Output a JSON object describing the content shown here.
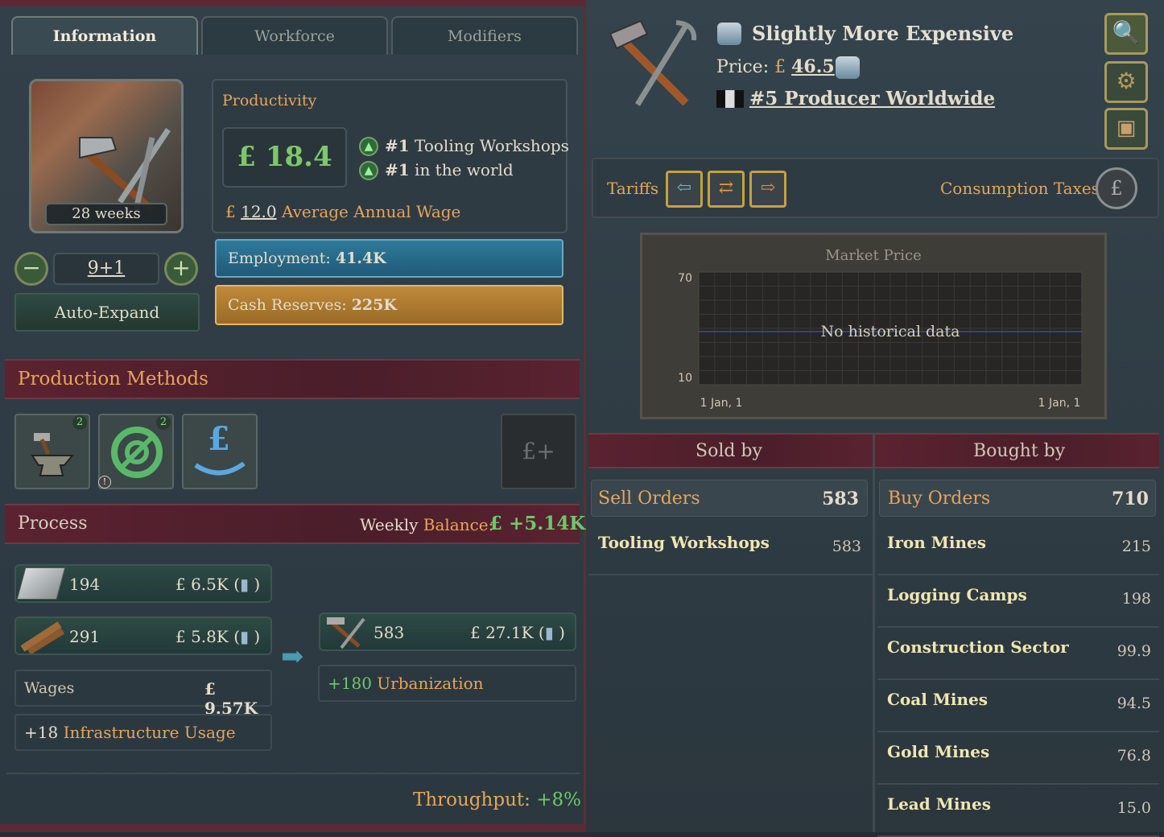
{
  "tabs": {
    "information": "Information",
    "workforce": "Workforce",
    "modifiers": "Modifiers"
  },
  "building": {
    "weeks": "28 weeks",
    "level": "9+1",
    "auto_expand": "Auto-Expand"
  },
  "productivity": {
    "title": "Productivity",
    "value": "£ 18.4",
    "rank1_prefix": "#1",
    "rank1_text": "Tooling Workshops",
    "rank2_prefix": "#1",
    "rank2_text": "in the world",
    "wage_currency": "£",
    "wage_value": "12.0",
    "wage_label": "Average Annual Wage"
  },
  "employment": {
    "label": "Employment:",
    "value": "41.4K"
  },
  "cash": {
    "label": "Cash Reserves:",
    "value": "225K"
  },
  "production_methods": {
    "title": "Production Methods",
    "badge1": "2",
    "badge2": "2",
    "currency_btn": "£+"
  },
  "process": {
    "title": "Process",
    "balance_prefix": "Weekly",
    "balance_label": "Balance:",
    "balance_value": "£ +5.14K",
    "inputs": [
      {
        "qty": "194",
        "cost": "£ 6.5K ("
      },
      {
        "qty": "291",
        "cost": "£ 5.8K ("
      }
    ],
    "wages_label": "Wages",
    "wages_value": "£ 9.57K",
    "infra_value": "+18",
    "infra_label": "Infrastructure Usage",
    "output": {
      "qty": "583",
      "value": "£ 27.1K ("
    },
    "urban_value": "+180",
    "urban_label": "Urbanization",
    "throughput_label": "Throughput:",
    "throughput_value": "+8%"
  },
  "goods": {
    "name": "Slightly More Expensive",
    "price_label": "Price:",
    "price_currency": "£",
    "price_value": "46.5",
    "producer_rank": "#5 Producer Worldwide"
  },
  "tariffs": {
    "label": "Tariffs",
    "consumption_label": "Consumption Taxes"
  },
  "chart_data": {
    "type": "line",
    "title": "Market Price",
    "ylim": [
      10,
      70
    ],
    "yticks": [
      "70",
      "10"
    ],
    "xticks": [
      "1 Jan, 1",
      "1 Jan, 1"
    ],
    "annotation": "No historical data",
    "series": []
  },
  "market": {
    "sold_by": "Sold by",
    "bought_by": "Bought by",
    "sell_orders_label": "Sell Orders",
    "sell_orders_value": "583",
    "buy_orders_label": "Buy Orders",
    "buy_orders_value": "710",
    "sellers": [
      {
        "name": "Tooling Workshops",
        "value": "583"
      }
    ],
    "buyers": [
      {
        "name": "Iron Mines",
        "value": "215"
      },
      {
        "name": "Logging Camps",
        "value": "198"
      },
      {
        "name": "Construction Sector",
        "value": "99.9"
      },
      {
        "name": "Coal Mines",
        "value": "94.5"
      },
      {
        "name": "Gold Mines",
        "value": "76.8"
      },
      {
        "name": "Lead Mines",
        "value": "15.0"
      }
    ]
  }
}
